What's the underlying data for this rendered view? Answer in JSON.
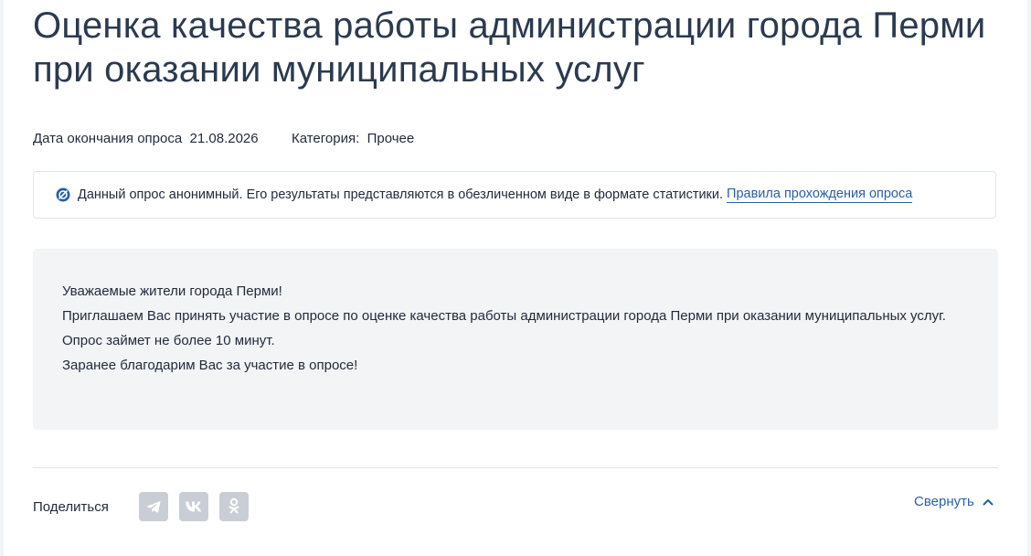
{
  "survey": {
    "title": "Оценка качества работы администрации города Перми при оказании муниципальных услуг",
    "end_date_label": "Дата окончания опроса",
    "end_date": "21.08.2026",
    "category_label": "Категория:",
    "category": "Прочее"
  },
  "notice": {
    "icon": "anonymous-icon",
    "text": "Данный опрос анонимный. Его результаты представляются в обезличенном виде в формате статистики.",
    "link_label": "Правила прохождения опроса"
  },
  "intro": {
    "lines": [
      "Уважаемые жители города Перми!",
      "Приглашаем Вас принять участие в опросе по оценке качества работы администрации города Перми при оказании муниципальных услуг.",
      "Опрос займет не более 10 минут.",
      "Заранее благодарим Вас за участие в опросе!"
    ]
  },
  "share": {
    "label": "Поделиться",
    "buttons": [
      {
        "icon": "telegram-icon"
      },
      {
        "icon": "vk-icon"
      },
      {
        "icon": "odnoklassniki-icon"
      }
    ]
  },
  "collapse": {
    "label": "Свернуть",
    "icon": "chevron-up-icon"
  },
  "colors": {
    "title": "#2b3a4f",
    "link": "#2a5fa3",
    "panel_bg": "#f3f4f6",
    "share_button_bg": "#c9ced6"
  }
}
